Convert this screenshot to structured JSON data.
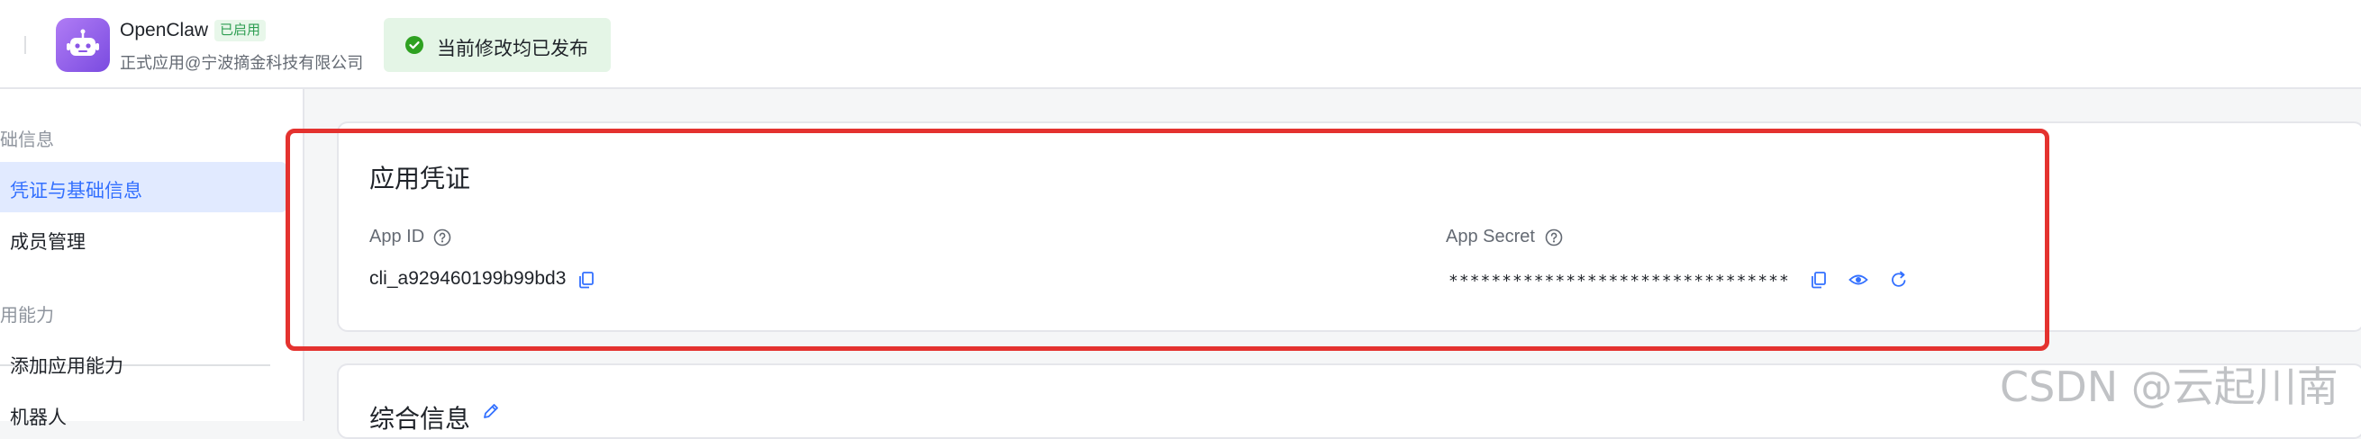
{
  "header": {
    "app_name": "OpenClaw",
    "app_status": "已启用",
    "app_subtitle": "正式应用@宁波摘金科技有限公司",
    "publish_status": "当前修改均已发布"
  },
  "sidebar": {
    "groups": [
      {
        "label": "础信息",
        "items": [
          {
            "label": "凭证与基础信息",
            "active": true
          },
          {
            "label": "成员管理",
            "active": false
          }
        ]
      },
      {
        "label": "用能力",
        "items": [
          {
            "label": "添加应用能力",
            "active": false
          },
          {
            "label": "机器人",
            "active": false
          }
        ]
      }
    ]
  },
  "credentials": {
    "title": "应用凭证",
    "app_id_label": "App ID",
    "app_id_value": "cli_a929460199b99bd3",
    "app_secret_label": "App Secret",
    "app_secret_value": "********************************"
  },
  "general_info": {
    "title": "综合信息"
  },
  "watermark": "CSDN @云起川南",
  "colors": {
    "accent": "#3370ff",
    "highlight_border": "#e4322f",
    "success_bg": "#e4f5e6",
    "success_icon": "#2ea121"
  },
  "icons": {
    "app": "robot-icon",
    "publish": "check-circle-icon",
    "help": "question-circle-icon",
    "copy": "copy-icon",
    "reveal": "eye-icon",
    "reset": "refresh-icon",
    "edit": "pencil-icon"
  }
}
